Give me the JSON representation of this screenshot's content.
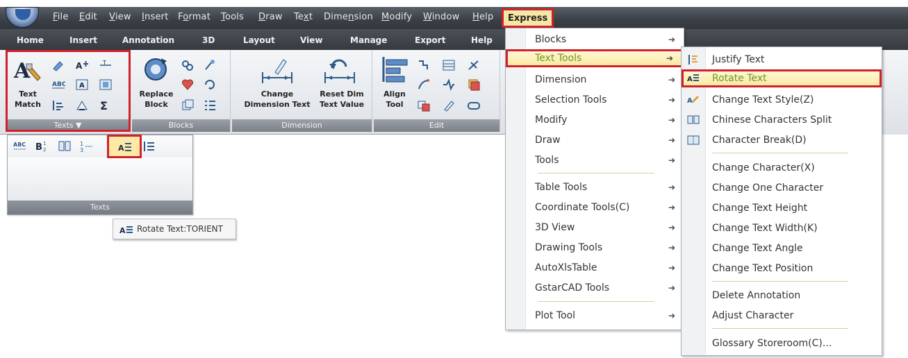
{
  "menubar": {
    "items": [
      {
        "label": "File",
        "ul": "F",
        "rest": "ile"
      },
      {
        "label": "Edit",
        "ul": "E",
        "rest": "dit"
      },
      {
        "label": "View",
        "ul": "V",
        "rest": "iew"
      },
      {
        "label": "Insert",
        "ul": "I",
        "rest": "nsert"
      },
      {
        "label": "Format",
        "pre": "F",
        "ul": "o",
        "rest": "rmat"
      },
      {
        "label": "Tools",
        "ul": "T",
        "rest": "ools"
      },
      {
        "label": "Draw",
        "ul": "D",
        "rest": "raw"
      },
      {
        "label": "Text",
        "pre": "Te",
        "ul": "x",
        "rest": "t"
      },
      {
        "label": "Dimension",
        "pre": "Dime",
        "ul": "n",
        "rest": "sion"
      },
      {
        "label": "Modify",
        "ul": "M",
        "rest": "odify"
      },
      {
        "label": "Window",
        "ul": "W",
        "rest": "indow"
      },
      {
        "label": "Help",
        "ul": "H",
        "rest": "elp"
      }
    ],
    "express": "Express"
  },
  "tabs": [
    "Home",
    "Insert",
    "Annotation",
    "3D",
    "Layout",
    "View",
    "Manage",
    "Export",
    "Help"
  ],
  "ribbon": {
    "text_match": "Text\nMatch",
    "texts_panel": "Texts ▼",
    "replace_block": "Replace\nBlock",
    "blocks_panel": "Blocks",
    "change_dim_text": "Change\nDimension Text",
    "reset_dim": "Reset Dim\nText Value",
    "dimension_panel": "Dimension",
    "align_tool": "Align\nTool",
    "edit_panel": "Edit"
  },
  "flyout": {
    "title": "Texts"
  },
  "tooltip": "Rotate Text:TORIENT",
  "express_menu": {
    "items": [
      {
        "label": "Blocks",
        "arrow": true
      },
      {
        "label": "Text Tools",
        "arrow": true
      },
      {
        "label": "Dimension",
        "arrow": true
      },
      {
        "label": "Selection Tools",
        "arrow": true
      },
      {
        "label": "Modify",
        "arrow": true
      },
      {
        "label": "Draw",
        "arrow": true
      },
      {
        "label": "Tools",
        "arrow": true
      },
      {
        "label": "Table Tools",
        "arrow": true
      },
      {
        "label": "Coordinate Tools(C)",
        "arrow": true
      },
      {
        "label": "3D View",
        "arrow": true
      },
      {
        "label": "Drawing Tools",
        "arrow": true
      },
      {
        "label": "AutoXlsTable",
        "arrow": true
      },
      {
        "label": "GstarCAD Tools",
        "arrow": true
      },
      {
        "label": "Plot Tool",
        "arrow": true
      }
    ],
    "arrow_glyph": "➔"
  },
  "text_tools_menu": {
    "items": [
      {
        "label": "Justify Text"
      },
      {
        "label": "Rotate Text"
      },
      {
        "label": "Change Text Style(Z)"
      },
      {
        "label": "Chinese Characters Split"
      },
      {
        "label": "Character Break(D)"
      },
      {
        "label": "Change Character(X)"
      },
      {
        "label": "Change One Character"
      },
      {
        "label": "Change Text Height"
      },
      {
        "label": "Change Text Width(K)"
      },
      {
        "label": "Change Text Angle"
      },
      {
        "label": "Change Text Position"
      },
      {
        "label": "Delete Annotation"
      },
      {
        "label": "Adjust Character"
      },
      {
        "label": "Glossary Storeroom(C)..."
      }
    ]
  },
  "colors": {
    "highlight_border": "#d0202a",
    "highlight_text": "#6a9a1a",
    "highlight_fill": "#fde9a4"
  }
}
